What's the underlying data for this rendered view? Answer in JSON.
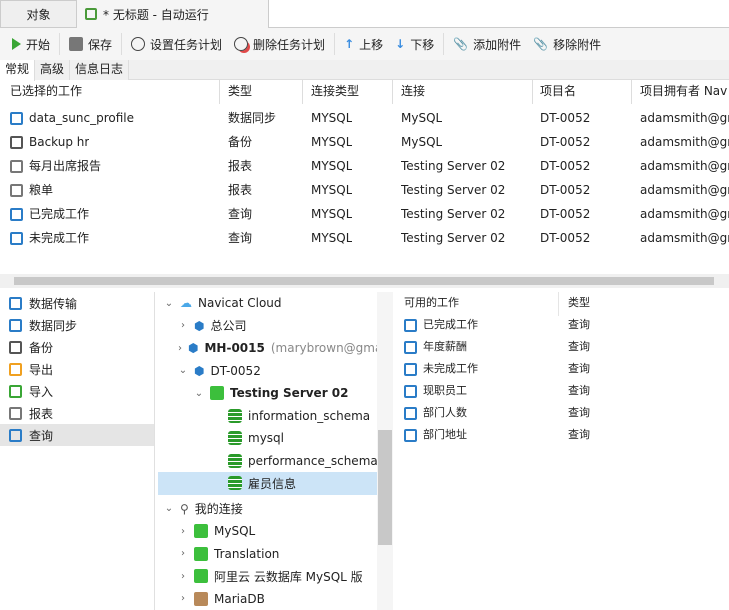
{
  "tabs": {
    "objects": "对象",
    "current": "* 无标题 - 自动运行"
  },
  "toolbar": {
    "start": "开始",
    "save": "保存",
    "set_schedule": "设置任务计划",
    "delete_schedule": "删除任务计划",
    "move_up": "上移",
    "move_down": "下移",
    "add_attachment": "添加附件",
    "remove_attachment": "移除附件"
  },
  "subtabs": [
    "常规",
    "高级",
    "信息日志"
  ],
  "table": {
    "columns": [
      "已选择的工作",
      "类型",
      "连接类型",
      "连接",
      "项目名",
      "项目拥有者 Nav"
    ],
    "rows": [
      [
        "data_sunc_profile",
        "数据同步",
        "MYSQL",
        "MySQL",
        "DT-0052",
        "adamsmith@gma"
      ],
      [
        "Backup hr",
        "备份",
        "MYSQL",
        "MySQL",
        "DT-0052",
        "adamsmith@gma"
      ],
      [
        "每月出席报告",
        "报表",
        "MYSQL",
        "Testing Server 02",
        "DT-0052",
        "adamsmith@gma"
      ],
      [
        "粮单",
        "报表",
        "MYSQL",
        "Testing Server 02",
        "DT-0052",
        "adamsmith@gma"
      ],
      [
        "已完成工作",
        "查询",
        "MYSQL",
        "Testing Server 02",
        "DT-0052",
        "adamsmith@gma"
      ],
      [
        "未完成工作",
        "查询",
        "MYSQL",
        "Testing Server 02",
        "DT-0052",
        "adamsmith@gma"
      ]
    ]
  },
  "categories": [
    "数据传输",
    "数据同步",
    "备份",
    "导出",
    "导入",
    "报表",
    "查询"
  ],
  "tree": {
    "cloud": "Navicat Cloud",
    "hq": "总公司",
    "mh": "MH-0015",
    "mh_owner": "(marybrown@gmail.com)",
    "dt": "DT-0052",
    "server": "Testing Server 02",
    "dbs": [
      "information_schema",
      "mysql",
      "performance_schema",
      "雇员信息"
    ],
    "my": "我的连接",
    "conns": [
      "MySQL",
      "Translation",
      "阿里云 云数据库 MySQL 版",
      "MariaDB"
    ]
  },
  "available": {
    "columns": [
      "可用的工作",
      "类型"
    ],
    "rows": [
      [
        "已完成工作",
        "查询"
      ],
      [
        "年度薪酬",
        "查询"
      ],
      [
        "未完成工作",
        "查询"
      ],
      [
        "现职员工",
        "查询"
      ],
      [
        "部门人数",
        "查询"
      ],
      [
        "部门地址",
        "查询"
      ]
    ]
  }
}
